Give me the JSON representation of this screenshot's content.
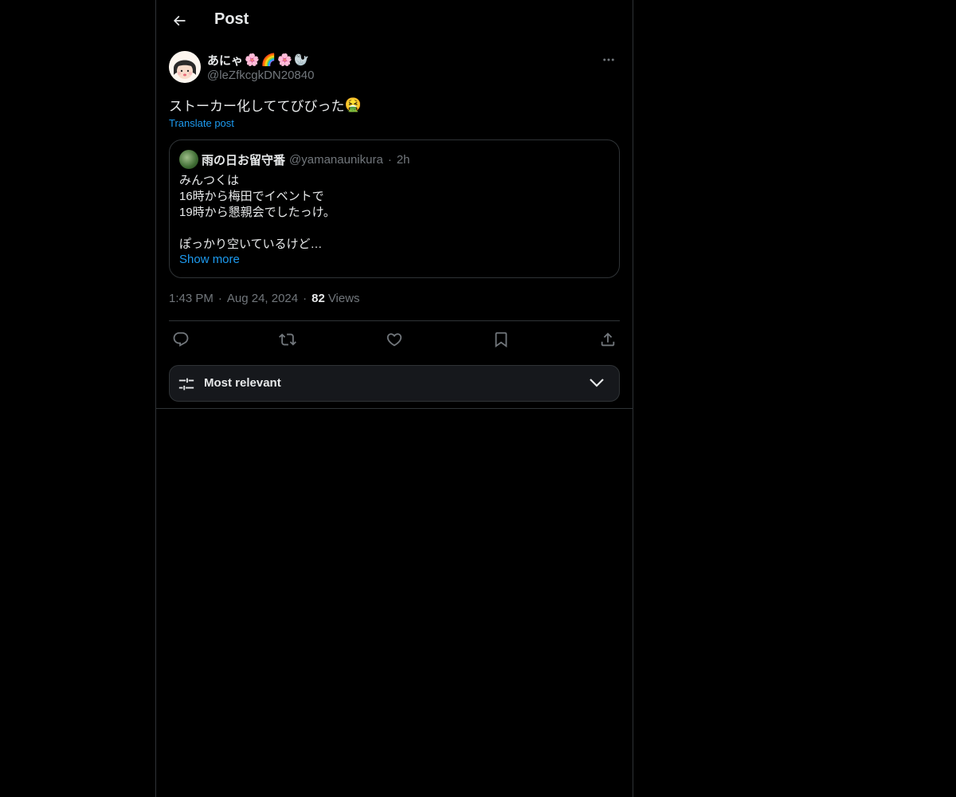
{
  "header": {
    "title": "Post"
  },
  "post": {
    "author": {
      "display_name": "あにゃ",
      "name_emojis": [
        "🌸",
        "🌈",
        "🌸",
        "🦭"
      ],
      "handle": "@leZfkcgkDN20840"
    },
    "text": "ストーカー化しててびびった",
    "text_emoji": "🤮",
    "translate_label": "Translate post",
    "quote": {
      "display_name": "雨の日お留守番",
      "handle": "@yamanaunikura",
      "separator": "·",
      "time": "2h",
      "lines": [
        "みんつくは",
        "16時から梅田でイベントで",
        "19時から懇親会でしたっけ。",
        "",
        "ぽっかり空いているけど…"
      ],
      "show_more_label": "Show more"
    },
    "meta": {
      "time": "1:43 PM",
      "date": "Aug 24, 2024",
      "separator": "·",
      "views_count": "82",
      "views_label": "Views"
    },
    "actions": [
      "reply-icon",
      "repost-icon",
      "like-icon",
      "bookmark-icon",
      "share-icon"
    ]
  },
  "replies_sort": {
    "label": "Most relevant"
  },
  "colors": {
    "background": "#000000",
    "text": "#e7e9ea",
    "muted": "#71767b",
    "accent": "#1d9bf0",
    "border": "#2f3336"
  }
}
